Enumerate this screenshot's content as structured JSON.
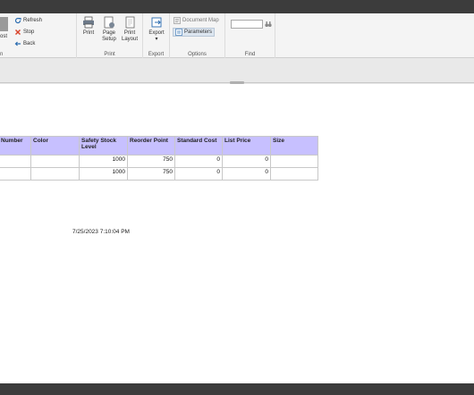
{
  "ribbon": {
    "run_group": {
      "partial_label": "ost",
      "group_label": "n",
      "refresh": "Refresh",
      "stop": "Stop",
      "back": "Back"
    },
    "print_group": {
      "label": "Print",
      "print": "Print",
      "page_setup_1": "Page",
      "page_setup_2": "Setup",
      "print_layout_1": "Print",
      "print_layout_2": "Layout"
    },
    "export_group": {
      "label": "Export",
      "export": "Export",
      "export_arrow": "▾"
    },
    "options_group": {
      "label": "Options",
      "document_map": "Document Map",
      "parameters": "Parameters"
    },
    "find_group": {
      "label": "Find"
    }
  },
  "report": {
    "headers": [
      "Number",
      "Color",
      "Safety Stock Level",
      "Reorder Point",
      "Standard Cost",
      "List Price",
      "Size"
    ],
    "rows": [
      [
        "",
        "",
        "1000",
        "750",
        "0",
        "0",
        ""
      ],
      [
        "",
        "",
        "1000",
        "750",
        "0",
        "0",
        ""
      ]
    ],
    "timestamp": "7/25/2023 7:10:04 PM"
  },
  "colors": {
    "header_bg": "#c7c0ff",
    "accent_blue": "#2b6cb0",
    "stop_red": "#d9442b"
  }
}
